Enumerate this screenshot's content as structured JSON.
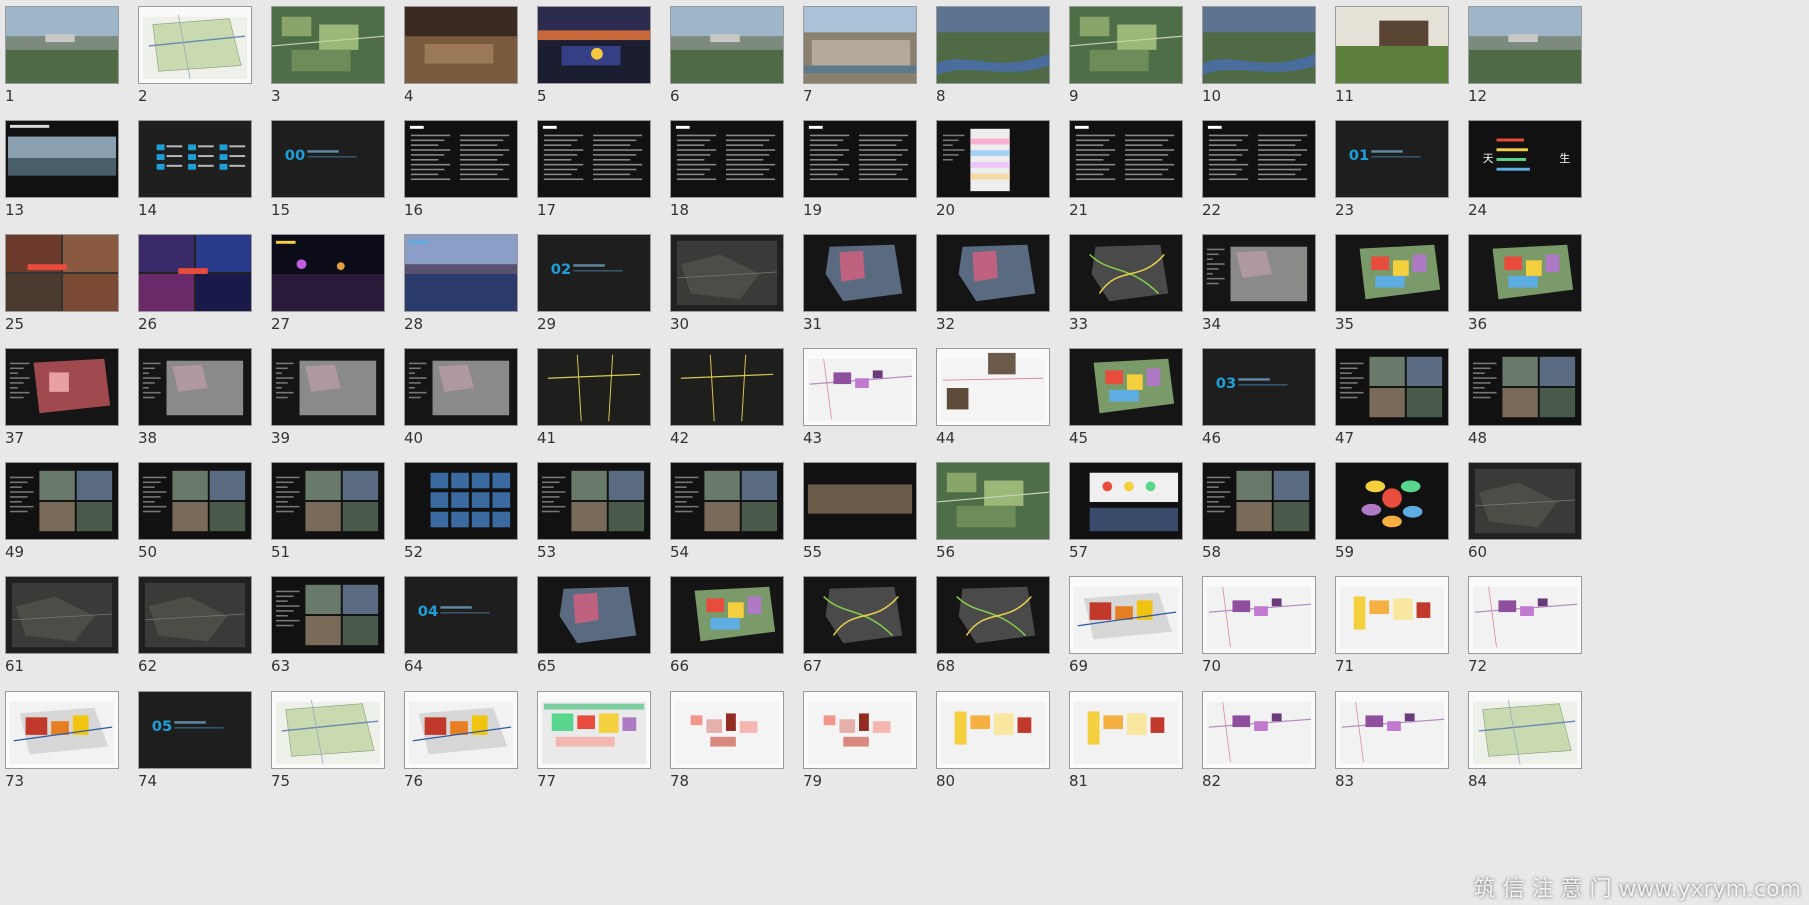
{
  "slides": [
    {
      "n": "1",
      "kind": "photo-sky"
    },
    {
      "n": "2",
      "kind": "plan-white"
    },
    {
      "n": "3",
      "kind": "aerial-green"
    },
    {
      "n": "4",
      "kind": "aerial-brown"
    },
    {
      "n": "5",
      "kind": "night-city"
    },
    {
      "n": "6",
      "kind": "photo-sky"
    },
    {
      "n": "7",
      "kind": "aerial-town"
    },
    {
      "n": "8",
      "kind": "aerial-river"
    },
    {
      "n": "9",
      "kind": "aerial-green"
    },
    {
      "n": "10",
      "kind": "aerial-river"
    },
    {
      "n": "11",
      "kind": "photo-building"
    },
    {
      "n": "12",
      "kind": "photo-sky"
    },
    {
      "n": "13",
      "kind": "photo-river-dark"
    },
    {
      "n": "14",
      "kind": "toc"
    },
    {
      "n": "15",
      "kind": "section",
      "label": "00"
    },
    {
      "n": "16",
      "kind": "text-dark"
    },
    {
      "n": "17",
      "kind": "text-dark"
    },
    {
      "n": "18",
      "kind": "text-dark"
    },
    {
      "n": "19",
      "kind": "text-dark"
    },
    {
      "n": "20",
      "kind": "table-color"
    },
    {
      "n": "21",
      "kind": "text-dark"
    },
    {
      "n": "22",
      "kind": "text-dark"
    },
    {
      "n": "23",
      "kind": "section",
      "label": "01"
    },
    {
      "n": "24",
      "kind": "tagline"
    },
    {
      "n": "25",
      "kind": "collage-red"
    },
    {
      "n": "26",
      "kind": "collage-purple"
    },
    {
      "n": "27",
      "kind": "night-water"
    },
    {
      "n": "28",
      "kind": "dusk-river"
    },
    {
      "n": "29",
      "kind": "section",
      "label": "02"
    },
    {
      "n": "30",
      "kind": "map-dark"
    },
    {
      "n": "31",
      "kind": "map-pink"
    },
    {
      "n": "32",
      "kind": "map-pink"
    },
    {
      "n": "33",
      "kind": "map-green-lines"
    },
    {
      "n": "34",
      "kind": "map-gray"
    },
    {
      "n": "35",
      "kind": "map-color"
    },
    {
      "n": "36",
      "kind": "map-color"
    },
    {
      "n": "37",
      "kind": "map-red"
    },
    {
      "n": "38",
      "kind": "map-gray"
    },
    {
      "n": "39",
      "kind": "map-gray"
    },
    {
      "n": "40",
      "kind": "map-gray"
    },
    {
      "n": "41",
      "kind": "map-dark-yellow"
    },
    {
      "n": "42",
      "kind": "map-dark-yellow"
    },
    {
      "n": "43",
      "kind": "plan-white-purple"
    },
    {
      "n": "44",
      "kind": "plan-white-photo"
    },
    {
      "n": "45",
      "kind": "map-color"
    },
    {
      "n": "46",
      "kind": "section",
      "label": "03"
    },
    {
      "n": "47",
      "kind": "photo-collage"
    },
    {
      "n": "48",
      "kind": "photo-collage"
    },
    {
      "n": "49",
      "kind": "photo-collage"
    },
    {
      "n": "50",
      "kind": "photo-collage"
    },
    {
      "n": "51",
      "kind": "photo-collage"
    },
    {
      "n": "52",
      "kind": "photo-grid-blue"
    },
    {
      "n": "53",
      "kind": "photo-collage"
    },
    {
      "n": "54",
      "kind": "photo-collage"
    },
    {
      "n": "55",
      "kind": "photo-dark-wide"
    },
    {
      "n": "56",
      "kind": "aerial-green"
    },
    {
      "n": "57",
      "kind": "diagram-white"
    },
    {
      "n": "58",
      "kind": "photo-collage"
    },
    {
      "n": "59",
      "kind": "diagram-bubbles"
    },
    {
      "n": "60",
      "kind": "map-dark"
    },
    {
      "n": "61",
      "kind": "map-dark"
    },
    {
      "n": "62",
      "kind": "map-dark"
    },
    {
      "n": "63",
      "kind": "photo-collage"
    },
    {
      "n": "64",
      "kind": "section",
      "label": "04"
    },
    {
      "n": "65",
      "kind": "map-pink"
    },
    {
      "n": "66",
      "kind": "map-color"
    },
    {
      "n": "67",
      "kind": "map-green-lines"
    },
    {
      "n": "68",
      "kind": "map-green-lines"
    },
    {
      "n": "69",
      "kind": "plan-white-red"
    },
    {
      "n": "70",
      "kind": "plan-white-purple"
    },
    {
      "n": "71",
      "kind": "plan-white-yellow"
    },
    {
      "n": "72",
      "kind": "plan-white-purple"
    },
    {
      "n": "73",
      "kind": "plan-white-red"
    },
    {
      "n": "74",
      "kind": "section",
      "label": "05"
    },
    {
      "n": "75",
      "kind": "plan-white"
    },
    {
      "n": "76",
      "kind": "plan-white-red"
    },
    {
      "n": "77",
      "kind": "plan-white-green"
    },
    {
      "n": "78",
      "kind": "plan-white-pink"
    },
    {
      "n": "79",
      "kind": "plan-white-pink"
    },
    {
      "n": "80",
      "kind": "plan-white-yellow"
    },
    {
      "n": "81",
      "kind": "plan-white-yellow"
    },
    {
      "n": "82",
      "kind": "plan-white-purple"
    },
    {
      "n": "83",
      "kind": "plan-white-purple"
    },
    {
      "n": "84",
      "kind": "plan-white"
    }
  ],
  "tagline_lines": [
    "天",
    "生"
  ],
  "watermark": "筑 信 注 意 门 www.yxrym.com",
  "colors": {
    "background": "#e8e8e8",
    "dark_slide": "#1b1b1b",
    "section_blue": "#1f9fd8"
  }
}
